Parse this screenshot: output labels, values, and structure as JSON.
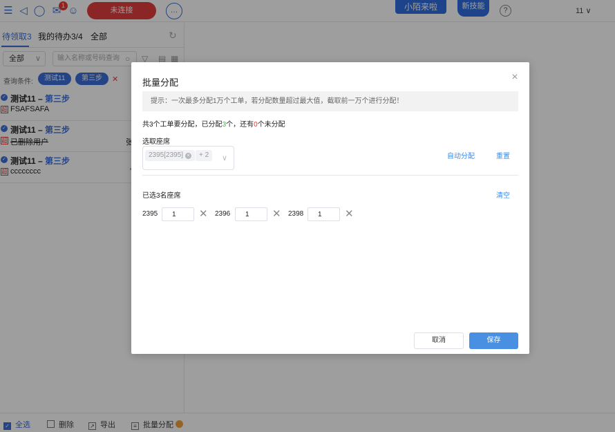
{
  "topbar": {
    "notification_badge": "1",
    "connection_status": "未连接",
    "promo_left": "小陌来啦",
    "promo_right": "新技能",
    "help": "?",
    "user": "11"
  },
  "left_panel": {
    "tabs": [
      "待领取3",
      "我的待办3/4",
      "全部"
    ],
    "filter_select": "全部",
    "search_placeholder": "输入名称或号码查询",
    "query_label": "查询条件:",
    "query_tags": [
      "测试11",
      "第三步"
    ],
    "items": [
      {
        "title": "测试11",
        "dash": " – ",
        "step": "第三步",
        "tag": "超",
        "sub": "FSAFSAFA",
        "right": ""
      },
      {
        "title": "测试11",
        "dash": " – ",
        "step": "第三步",
        "tag": "超",
        "sub": "已删除用户",
        "right": "张"
      },
      {
        "title": "测试11",
        "dash": " – ",
        "step": "第三步",
        "tag": "超",
        "sub": "cccccccc",
        "right": "'"
      }
    ]
  },
  "bottombar": {
    "select_all": "全选",
    "delete": "删除",
    "export": "导出",
    "batch_assign": "批量分配"
  },
  "modal": {
    "title": "批量分配",
    "tip": "提示：一次最多分配1万个工单，若分配数量超过最大值，截取前一万个进行分配！",
    "summary_prefix": "共3个工单要分配，已分配",
    "assigned": "3",
    "summary_mid": "个，还有",
    "remaining": "0",
    "summary_suffix": "个未分配",
    "seat_label": "选取座席",
    "seat_chip": "2395[2395]",
    "seat_more": "+ 2",
    "auto_assign": "自动分配",
    "reset": "重置",
    "selected_count": "已选3名座席",
    "clear": "清空",
    "seats": [
      {
        "id": "2395",
        "count": "1"
      },
      {
        "id": "2396",
        "count": "1"
      },
      {
        "id": "2398",
        "count": "1"
      }
    ],
    "cancel": "取消",
    "save": "保存"
  },
  "colors": {
    "accent": "#3a6fd8",
    "link": "#3a8ee6",
    "primary_button": "#4a90e2",
    "disconnect": "#e23c3c",
    "assigned_green": "#4caf50",
    "remaining_red": "#e53935"
  }
}
